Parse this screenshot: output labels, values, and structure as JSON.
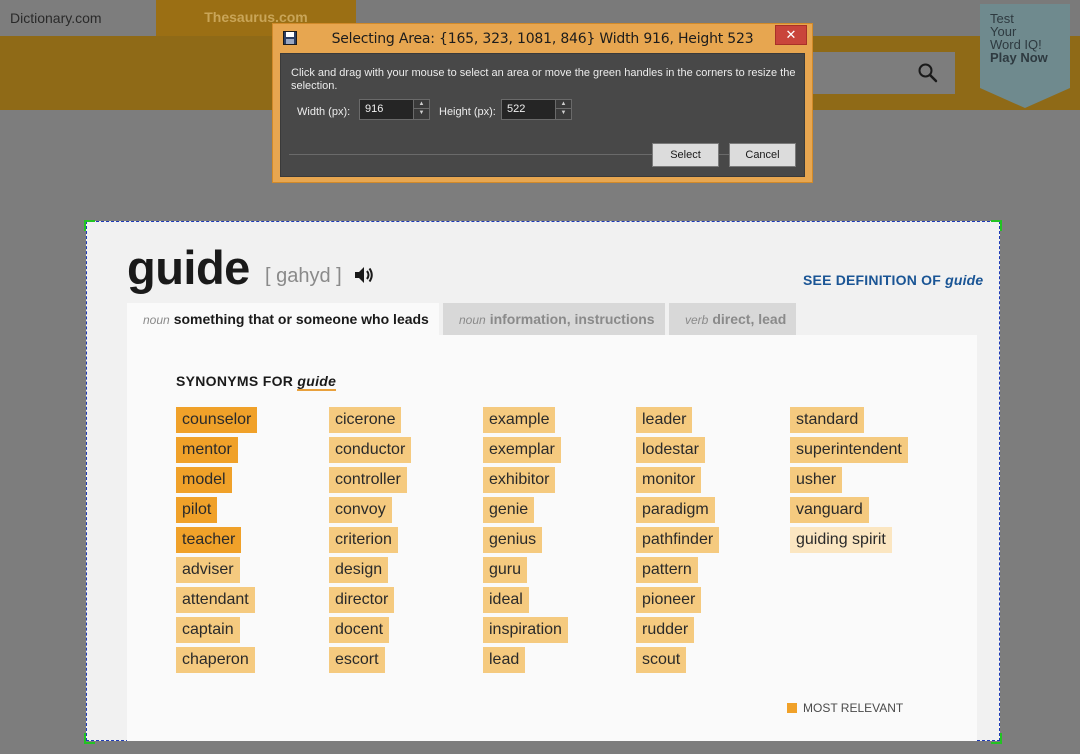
{
  "site": {
    "tab_dictionary": "Dictionary.com",
    "tab_thesaurus": "Thesaurus.com",
    "word_iq": {
      "line1": "Test",
      "line2": "Your",
      "line3": "Word IQ!",
      "line4": "Play Now"
    }
  },
  "dialog": {
    "title": "Selecting Area: {165, 323, 1081, 846} Width 916, Height 523",
    "close": "✕",
    "instructions": "Click and drag with your mouse to select an area or move the green handles in the corners to resize the selection.",
    "width_label": "Width (px):",
    "width_value": "916",
    "height_label": "Height (px):",
    "height_value": "522",
    "select_button": "Select",
    "cancel_button": "Cancel"
  },
  "entry": {
    "headword": "guide",
    "pronunciation": "[ gahyd ]",
    "see_definition_prefix": "SEE DEFINITION OF",
    "see_definition_word": "guide",
    "tabs": [
      {
        "pos": "noun",
        "label": "something that or someone who leads"
      },
      {
        "pos": "noun",
        "label": "information, instructions"
      },
      {
        "pos": "verb",
        "label": "direct, lead"
      }
    ],
    "synonyms_heading": "SYNONYMS FOR",
    "synonyms_word": "guide",
    "synonyms": [
      [
        {
          "word": "counselor",
          "relevance": 1
        },
        {
          "word": "mentor",
          "relevance": 1
        },
        {
          "word": "model",
          "relevance": 1
        },
        {
          "word": "pilot",
          "relevance": 1
        },
        {
          "word": "teacher",
          "relevance": 1
        },
        {
          "word": "adviser",
          "relevance": 2
        },
        {
          "word": "attendant",
          "relevance": 2
        },
        {
          "word": "captain",
          "relevance": 2
        },
        {
          "word": "chaperon",
          "relevance": 2
        }
      ],
      [
        {
          "word": "cicerone",
          "relevance": 2
        },
        {
          "word": "conductor",
          "relevance": 2
        },
        {
          "word": "controller",
          "relevance": 2
        },
        {
          "word": "convoy",
          "relevance": 2
        },
        {
          "word": "criterion",
          "relevance": 2
        },
        {
          "word": "design",
          "relevance": 2
        },
        {
          "word": "director",
          "relevance": 2
        },
        {
          "word": "docent",
          "relevance": 2
        },
        {
          "word": "escort",
          "relevance": 2
        }
      ],
      [
        {
          "word": "example",
          "relevance": 2
        },
        {
          "word": "exemplar",
          "relevance": 2
        },
        {
          "word": "exhibitor",
          "relevance": 2
        },
        {
          "word": "genie",
          "relevance": 2
        },
        {
          "word": "genius",
          "relevance": 2
        },
        {
          "word": "guru",
          "relevance": 2
        },
        {
          "word": "ideal",
          "relevance": 2
        },
        {
          "word": "inspiration",
          "relevance": 2
        },
        {
          "word": "lead",
          "relevance": 2
        }
      ],
      [
        {
          "word": "leader",
          "relevance": 2
        },
        {
          "word": "lodestar",
          "relevance": 2
        },
        {
          "word": "monitor",
          "relevance": 2
        },
        {
          "word": "paradigm",
          "relevance": 2
        },
        {
          "word": "pathfinder",
          "relevance": 2
        },
        {
          "word": "pattern",
          "relevance": 2
        },
        {
          "word": "pioneer",
          "relevance": 2
        },
        {
          "word": "rudder",
          "relevance": 2
        },
        {
          "word": "scout",
          "relevance": 2
        }
      ],
      [
        {
          "word": "standard",
          "relevance": 2
        },
        {
          "word": "superintendent",
          "relevance": 2
        },
        {
          "word": "usher",
          "relevance": 2
        },
        {
          "word": "vanguard",
          "relevance": 2
        },
        {
          "word": "guiding spirit",
          "relevance": 3
        }
      ]
    ],
    "legend_label": "MOST RELEVANT"
  },
  "colors": {
    "most_relevant": "#f0a129",
    "relevant": "#f5ca7f",
    "less_relevant": "#fbe6c1",
    "link_blue": "#1a5595",
    "dialog_frame": "#e7a650"
  }
}
